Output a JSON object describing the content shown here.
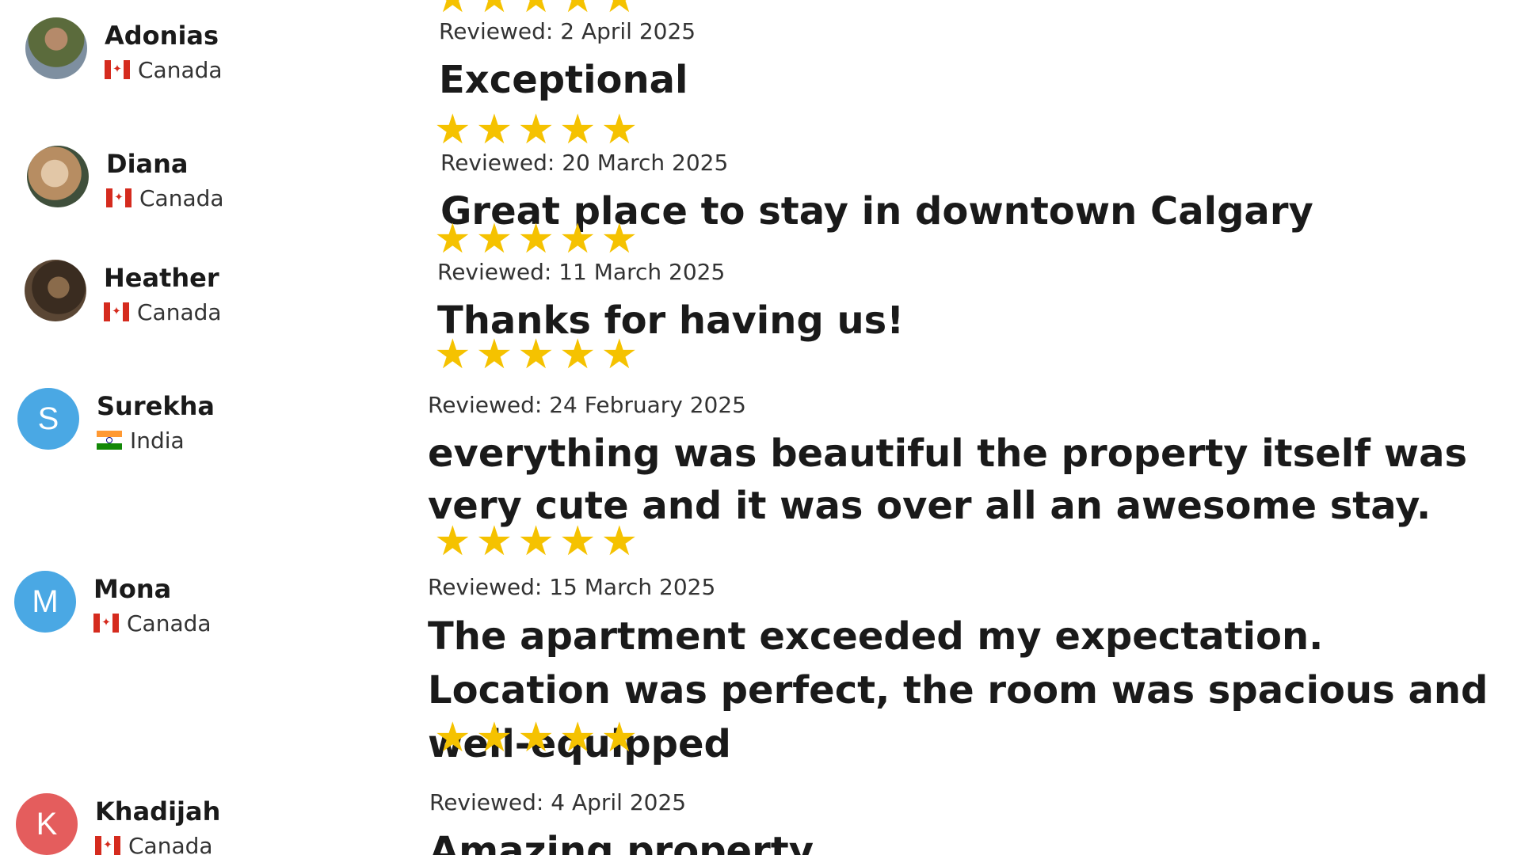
{
  "reviews": [
    {
      "reviewer": {
        "name": "Adonias",
        "country": "Canada",
        "flag": "canada-flag-icon",
        "avatar": "photo"
      },
      "stars": 5,
      "date": "Reviewed: 2 April 2025",
      "title": "Exceptional"
    },
    {
      "reviewer": {
        "name": "Diana",
        "country": "Canada",
        "flag": "canada-flag-icon",
        "avatar": "photo"
      },
      "stars": 5,
      "date": "Reviewed: 20 March 2025",
      "title": "Great place to stay in downtown Calgary"
    },
    {
      "reviewer": {
        "name": "Heather",
        "country": "Canada",
        "flag": "canada-flag-icon",
        "avatar": "photo"
      },
      "stars": 5,
      "date": "Reviewed: 11 March 2025",
      "title": "Thanks for having us!"
    },
    {
      "reviewer": {
        "name": "Surekha",
        "country": "India",
        "flag": "india-flag-icon",
        "avatar": "S",
        "avatar_color": "#4aa8e4"
      },
      "stars": 5,
      "date": "Reviewed: 24 February 2025",
      "title": "everything was beautiful the property itself was very cute and it was over all an awesome stay."
    },
    {
      "reviewer": {
        "name": "Mona",
        "country": "Canada",
        "flag": "canada-flag-icon",
        "avatar": "M",
        "avatar_color": "#4aa8e4"
      },
      "stars": 5,
      "date": "Reviewed: 15 March 2025",
      "title": "The apartment exceeded my expectation. Location was perfect, the room was spacious and well-equipped"
    },
    {
      "reviewer": {
        "name": "Khadijah",
        "country": "Canada",
        "flag": "canada-flag-icon",
        "avatar": "K",
        "avatar_color": "#e45d5d"
      },
      "stars": 5,
      "date": "Reviewed: 4 April 2025",
      "title": "Amazing property"
    }
  ],
  "colors": {
    "star": "#f5c200",
    "text": "#1a1a1a",
    "muted": "#333333"
  }
}
